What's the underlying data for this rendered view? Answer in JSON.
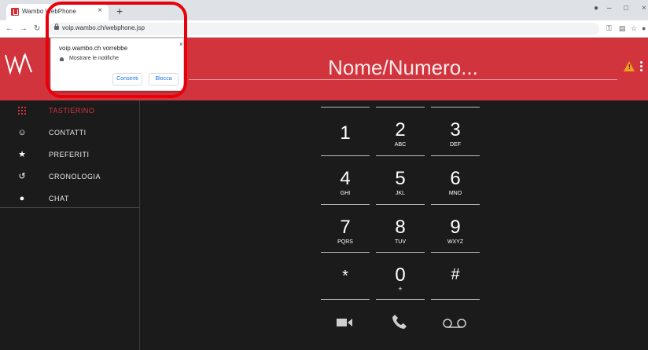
{
  "browser": {
    "tab_title": "Wambo WebPhone",
    "tab_close": "×",
    "new_tab": "+",
    "url": "voip.wambo.ch/webphone.jsp",
    "window_minimize": "–",
    "window_restore": "□",
    "window_close": "×"
  },
  "permission_popup": {
    "message": "voip.wambo.ch vorrebbe",
    "permission": "Mostrare le notifiche",
    "allow_label": "Consenti",
    "block_label": "Blocca",
    "close": "×"
  },
  "header": {
    "brand_color": "#d1343d",
    "search_placeholder": "Nome/Numero...",
    "warning_icon": "warning-icon",
    "warning_mark": "!"
  },
  "sidebar": {
    "items": [
      {
        "label": "TASTIERINO",
        "icon": "keypad-icon",
        "active": true
      },
      {
        "label": "CONTATTI",
        "icon": "contact-icon",
        "active": false
      },
      {
        "label": "PREFERITI",
        "icon": "star-icon",
        "active": false
      },
      {
        "label": "CRONOLOGIA",
        "icon": "history-icon",
        "active": false
      },
      {
        "label": "CHAT",
        "icon": "chat-icon",
        "active": false
      }
    ]
  },
  "dialpad": {
    "keys": [
      {
        "digit": "1",
        "letters": ""
      },
      {
        "digit": "2",
        "letters": "ABC"
      },
      {
        "digit": "3",
        "letters": "DEF"
      },
      {
        "digit": "4",
        "letters": "GHI"
      },
      {
        "digit": "5",
        "letters": "JKL"
      },
      {
        "digit": "6",
        "letters": "MNO"
      },
      {
        "digit": "7",
        "letters": "PQRS"
      },
      {
        "digit": "8",
        "letters": "TUV"
      },
      {
        "digit": "9",
        "letters": "WXYZ"
      },
      {
        "digit": "*",
        "letters": ""
      },
      {
        "digit": "0",
        "letters": "+"
      },
      {
        "digit": "#",
        "letters": ""
      }
    ],
    "actions": [
      "video-call-icon",
      "phone-call-icon",
      "voicemail-icon"
    ]
  }
}
